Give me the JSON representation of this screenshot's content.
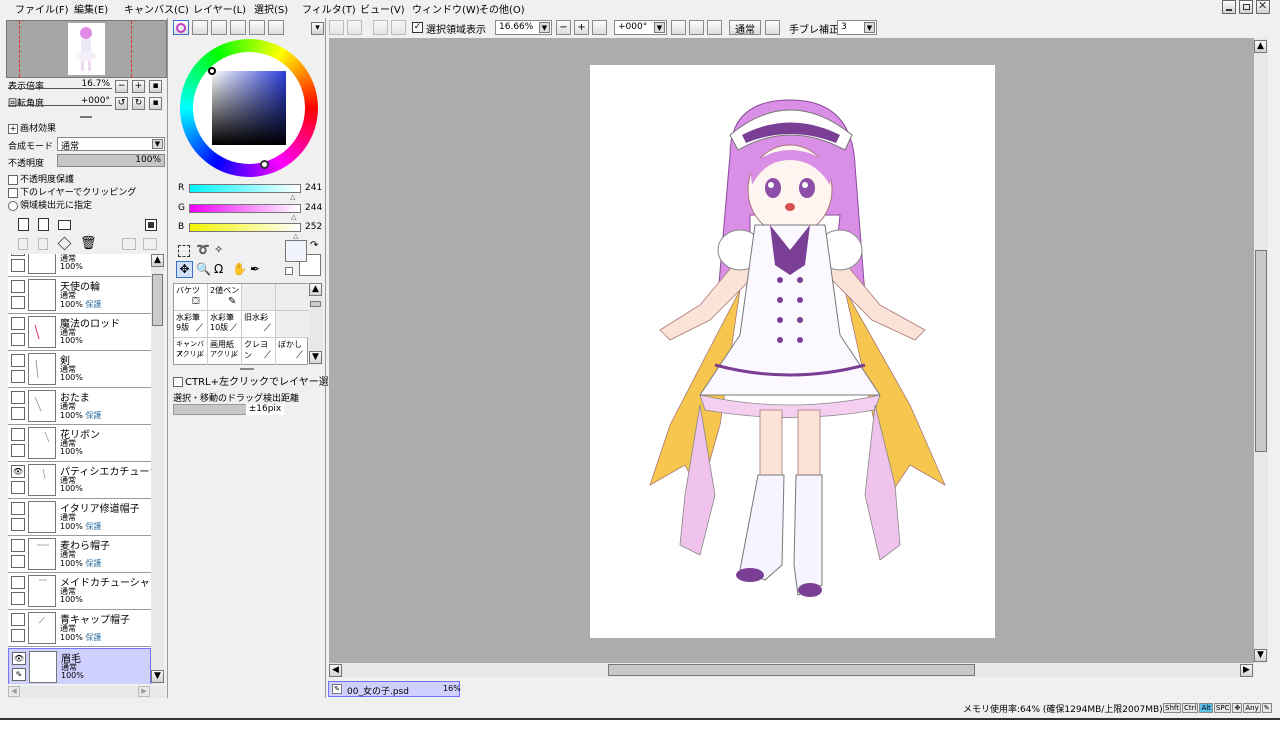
{
  "menu": [
    "ファイル(F)",
    "編集(E)",
    "キャンバス(C)",
    "レイヤー(L)",
    "選択(S)",
    "フィルタ(T)",
    "ビュー(V)",
    "ウィンドウ(W)",
    "その他(O)"
  ],
  "navigator": {
    "zoom_label": "表示倍率",
    "zoom_value": "16.7%",
    "angle_label": "回転角度",
    "angle_value": "+000°"
  },
  "layer_props": {
    "effect_label": "画材効果",
    "blend_label": "合成モード",
    "blend_value": "通常",
    "opacity_label": "不透明度",
    "opacity_value": "100%",
    "protect": "不透明度保護",
    "clip": "下のレイヤーでクリッピング",
    "source": "領域検出元に指定"
  },
  "layers": [
    {
      "name": "",
      "mode": "通常",
      "opacity": "100%",
      "protect": ""
    },
    {
      "name": "天使の輪",
      "mode": "通常",
      "opacity": "100%",
      "protect": "保護"
    },
    {
      "name": "魔法のロッド",
      "mode": "通常",
      "opacity": "100%",
      "protect": ""
    },
    {
      "name": "剣",
      "mode": "通常",
      "opacity": "100%",
      "protect": ""
    },
    {
      "name": "おたま",
      "mode": "通常",
      "opacity": "100%",
      "protect": "保護"
    },
    {
      "name": "花リボン",
      "mode": "通常",
      "opacity": "100%",
      "protect": ""
    },
    {
      "name": "パティシエカチューシャ",
      "mode": "通常",
      "opacity": "100%",
      "protect": ""
    },
    {
      "name": "イタリア修道帽子",
      "mode": "通常",
      "opacity": "100%",
      "protect": "保護"
    },
    {
      "name": "麦わら帽子",
      "mode": "通常",
      "opacity": "100%",
      "protect": "保護"
    },
    {
      "name": "メイドカチューシャ",
      "mode": "通常",
      "opacity": "100%",
      "protect": ""
    },
    {
      "name": "青キャップ帽子",
      "mode": "通常",
      "opacity": "100%",
      "protect": "保護"
    },
    {
      "name": "眉毛",
      "mode": "通常",
      "opacity": "100%",
      "protect": ""
    }
  ],
  "color": {
    "r_label": "R",
    "r": "241",
    "g_label": "G",
    "g": "244",
    "b_label": "B",
    "b": "252",
    "fg": "#f1f4fc"
  },
  "brushes": [
    {
      "name": "バケツ"
    },
    {
      "name": "2値ペン"
    },
    {
      "name": ""
    },
    {
      "name": ""
    },
    {
      "name": "水彩筆",
      "sub": "9版"
    },
    {
      "name": "水彩筆",
      "sub": "10版"
    },
    {
      "name": "旧水彩"
    },
    {
      "name": ""
    },
    {
      "name": "キャンバス",
      "sub": "アクリル"
    },
    {
      "name": "画用紙",
      "sub": "アクリル"
    },
    {
      "name": "クレヨン"
    },
    {
      "name": "ぼかし"
    }
  ],
  "tool_opts": {
    "ctrl_click": "CTRL+左クリックでレイヤー選択",
    "drag_label": "選択・移動のドラッグ検出距離",
    "drag_value": "±16pix"
  },
  "toolbar": {
    "selection_display": "選択領域表示",
    "zoom": "16.66%",
    "angle": "+000°",
    "mode": "通常",
    "stabilizer_label": "手ブレ補正",
    "stabilizer": "3"
  },
  "doc_tab": {
    "name": "00_女の子.psd",
    "zoom": "16%"
  },
  "status": {
    "memory": "メモリ使用率:64% (確保1294MB/上限2007MB)",
    "keys": [
      "Shft",
      "Ctrl",
      "Alt",
      "SPC",
      "Any"
    ]
  }
}
